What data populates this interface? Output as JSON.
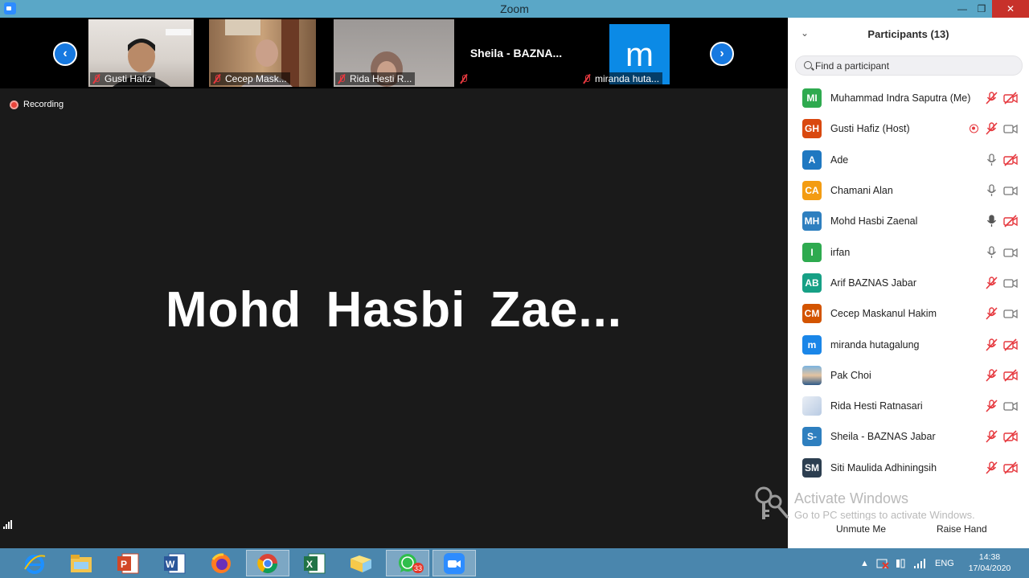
{
  "window": {
    "title": "Zoom"
  },
  "strip": {
    "tiles": [
      {
        "name": "Gusti Hafiz"
      },
      {
        "name": "Cecep Mask..."
      },
      {
        "name": "Rida Hesti R..."
      },
      {
        "name": "",
        "label": "Sheila  -  BAZNA..."
      },
      {
        "name": "miranda huta...",
        "avatar_letter": "m"
      }
    ]
  },
  "recording": {
    "label": "Recording"
  },
  "main": {
    "speaker_name": "Mohd  Hasbi  Zae..."
  },
  "participants": {
    "title": "Participants (13)",
    "search_placeholder": "Find a participant",
    "items": [
      {
        "initials": "MI",
        "name": "Muhammad Indra Saputra (Me)",
        "color": "#2eaa4f",
        "mic": "muted",
        "video": "off",
        "recording": false
      },
      {
        "initials": "GH",
        "name": "Gusti Hafiz (Host)",
        "color": "#d9480f",
        "mic": "muted",
        "video": "on",
        "recording": true
      },
      {
        "initials": "A",
        "name": "Ade",
        "color": "#1f78c1",
        "mic": "on",
        "video": "off",
        "recording": false
      },
      {
        "initials": "CA",
        "name": "Chamani Alan",
        "color": "#f39c12",
        "mic": "on",
        "video": "on",
        "recording": false
      },
      {
        "initials": "MH",
        "name": "Mohd Hasbi Zaenal",
        "color": "#2e7fbf",
        "mic": "speaking",
        "video": "off",
        "recording": false
      },
      {
        "initials": "I",
        "name": "irfan",
        "color": "#2eaa4f",
        "mic": "on",
        "video": "on",
        "recording": false
      },
      {
        "initials": "AB",
        "name": "Arif BAZNAS Jabar",
        "color": "#16a085",
        "mic": "muted",
        "video": "on",
        "recording": false
      },
      {
        "initials": "CM",
        "name": "Cecep Maskanul Hakim",
        "color": "#d35400",
        "mic": "muted",
        "video": "on",
        "recording": false
      },
      {
        "initials": "m",
        "name": "miranda hutagalung",
        "color": "#1a86e8",
        "mic": "muted",
        "video": "off",
        "recording": false
      },
      {
        "initials": "",
        "name": "Pak Choi",
        "color": "photo",
        "mic": "muted",
        "video": "off",
        "recording": false
      },
      {
        "initials": "",
        "name": "Rida Hesti Ratnasari",
        "color": "doc",
        "mic": "muted",
        "video": "on",
        "recording": false
      },
      {
        "initials": "S-",
        "name": "Sheila - BAZNAS Jabar",
        "color": "#2e7fbf",
        "mic": "muted",
        "video": "off",
        "recording": false
      },
      {
        "initials": "SM",
        "name": "Siti Maulida Adhiningsih",
        "color": "#2c3e50",
        "mic": "muted",
        "video": "off",
        "recording": false
      }
    ],
    "unmute_label": "Unmute Me",
    "raise_hand_label": "Raise Hand"
  },
  "watermark": {
    "line1": "Activate Windows",
    "line2": "Go to PC settings to activate Windows."
  },
  "taskbar": {
    "apps": [
      "internet-explorer",
      "file-explorer",
      "powerpoint",
      "word",
      "firefox",
      "chrome",
      "excel",
      "folder",
      "whatsapp",
      "zoom"
    ],
    "whatsapp_badge": "33",
    "language": "ENG",
    "time": "14:38",
    "date": "17/04/2020"
  }
}
